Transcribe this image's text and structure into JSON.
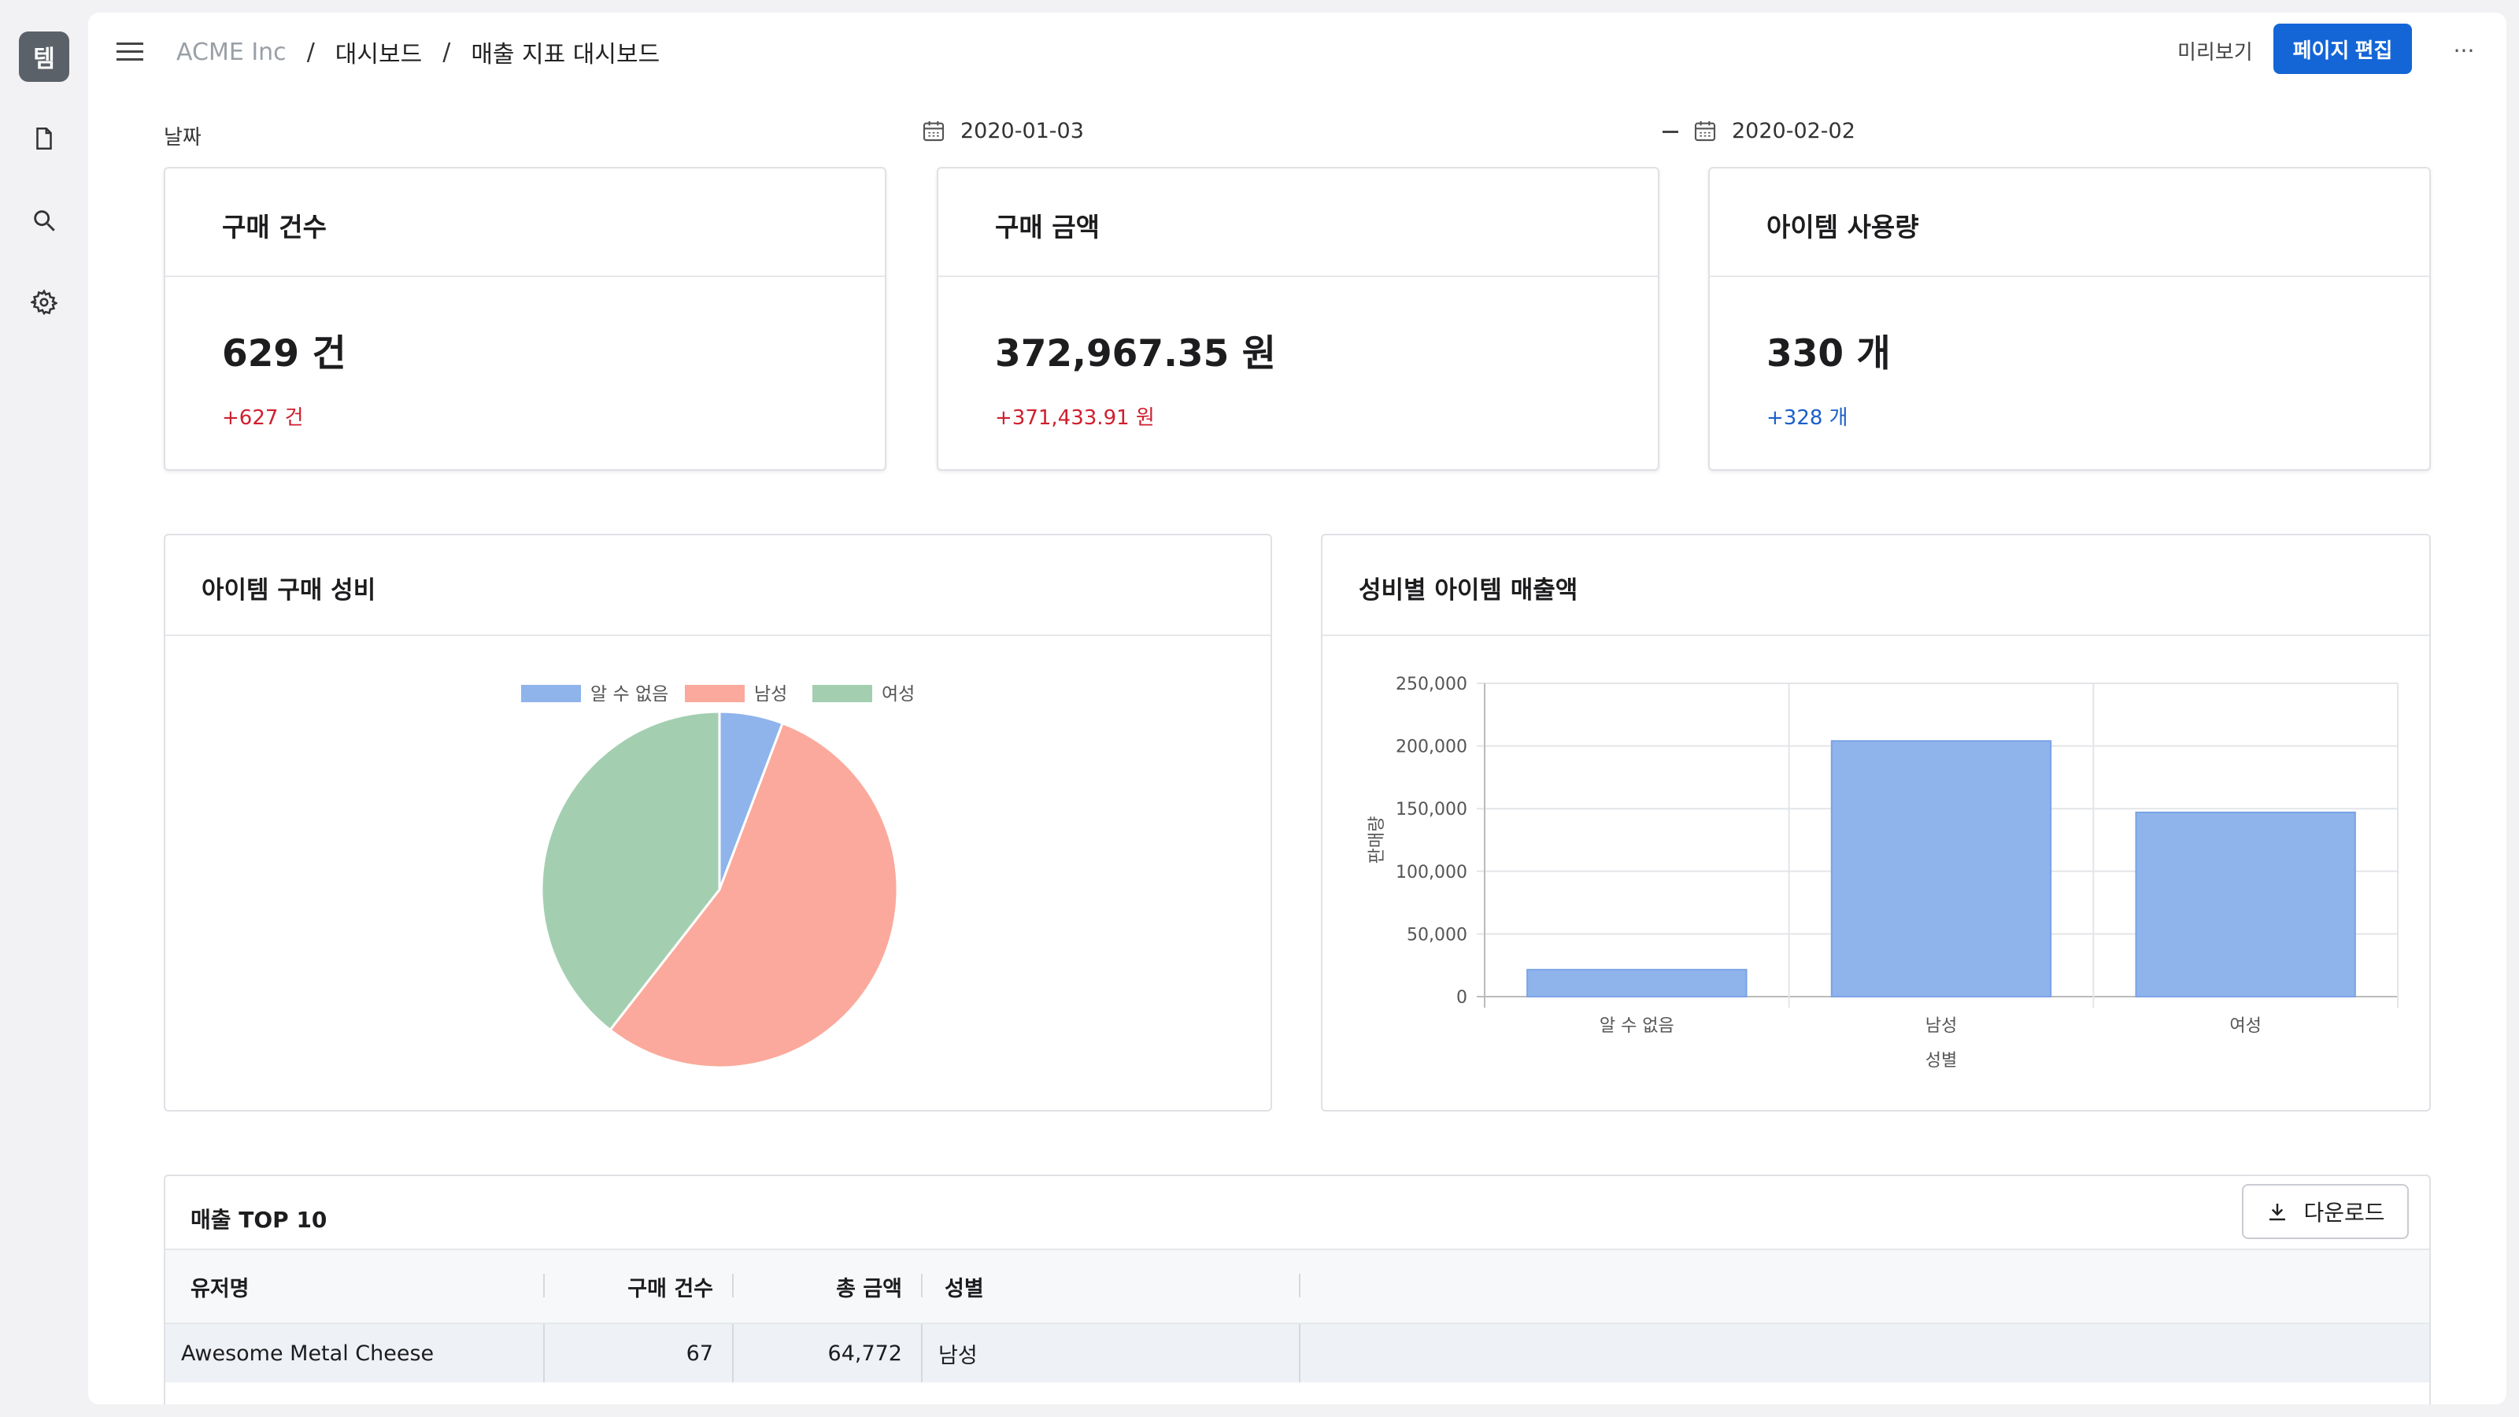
{
  "app": {
    "logo_text": "템"
  },
  "breadcrumb": {
    "org": "ACME Inc",
    "section": "대시보드",
    "page": "매출 지표 대시보드"
  },
  "header": {
    "preview_label": "미리보기",
    "edit_label": "페이지 편집",
    "more_label": "···"
  },
  "date_filter": {
    "label": "날짜",
    "start": "2020-01-03",
    "end": "2020-02-02"
  },
  "kpis": [
    {
      "title": "구매 건수",
      "value": "629 건",
      "delta": "+627 건",
      "delta_color": "#cf1f2e"
    },
    {
      "title": "구매 금액",
      "value": "372,967.35 원",
      "delta": "+371,433.91 원",
      "delta_color": "#cf1f2e"
    },
    {
      "title": "아이템 사용량",
      "value": "330 개",
      "delta": "+328 개",
      "delta_color": "#1a5fc9"
    }
  ],
  "pie_panel": {
    "title": "아이템 구매 성비"
  },
  "bar_panel": {
    "title": "성비별 아이템 매출액"
  },
  "colors": {
    "unknown": "#8fb4ec",
    "male": "#fba99c",
    "female": "#a3cfb0",
    "bar": "#8fb4ec",
    "accent": "#1466d6"
  },
  "chart_data": [
    {
      "type": "pie",
      "legend_position": "top",
      "categories": [
        "알 수 없음",
        "남성",
        "여성"
      ],
      "values": [
        21500,
        204000,
        147000
      ]
    },
    {
      "type": "bar",
      "categories": [
        "알 수 없음",
        "남성",
        "여성"
      ],
      "values": [
        21500,
        204000,
        147000
      ],
      "xlabel": "성별",
      "ylabel": "판매량",
      "ylim": [
        0,
        250000
      ],
      "yticks": [
        "0",
        "50,000",
        "100,000",
        "150,000",
        "200,000",
        "250,000"
      ],
      "grid": true
    }
  ],
  "table": {
    "title": "매출 TOP 10",
    "download_label": "다운로드",
    "columns": [
      "유저명",
      "구매 건수",
      "총 금액",
      "성별"
    ],
    "rows": [
      [
        "Awesome Metal Cheese",
        "67",
        "64,772",
        "남성"
      ]
    ]
  }
}
